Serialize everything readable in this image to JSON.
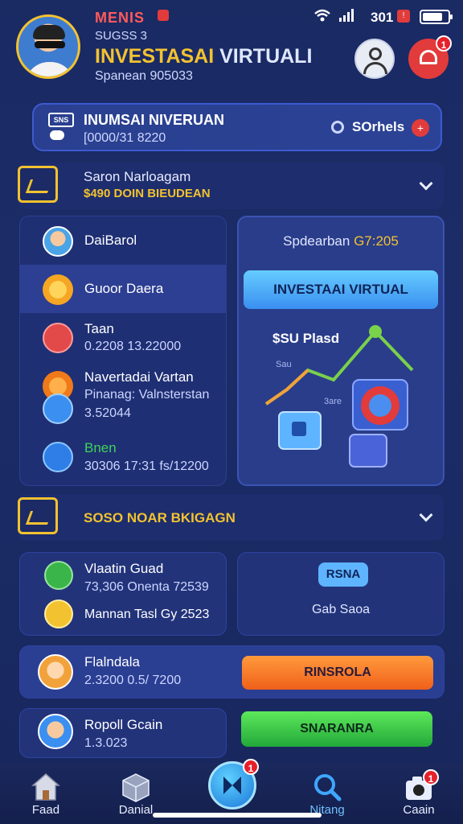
{
  "status": {
    "time": "301"
  },
  "header": {
    "brand": "MENIS",
    "subline": "SUGSS 3",
    "title_a": "INVESTASAI",
    "title_b": "VIRTUALI",
    "tagline": "Spanean 905033"
  },
  "notice": {
    "title": "INUMSAI NIVERUAN",
    "subtitle": "[0000/31 8220",
    "box_label": "SNS",
    "filter_label": "SOrhels"
  },
  "section1": {
    "title": "Saron Narloagam",
    "subtitle": "$490 DOIN BIEUDEAN"
  },
  "list": [
    {
      "title": "DaiBarol",
      "sub": ""
    },
    {
      "title": "Guoor Daera",
      "sub": ""
    },
    {
      "title": "Taan",
      "sub": "0.2208 13.22000"
    },
    {
      "title": "Navertadai Vartan",
      "sub": "Pinanag: Valnsterstan"
    },
    {
      "title": "",
      "sub": "3.52044"
    },
    {
      "title": "Bnen",
      "sub": "30306 17:31 fs/12200"
    }
  ],
  "promo": {
    "head_a": "Spdearban",
    "head_b": "G7:205",
    "button": "INVESTAAI VIRTUAL",
    "chart_label": "$SU Plasd",
    "chart_small1": "Sau",
    "chart_small2": "3are"
  },
  "section2": {
    "title": "SOSO NOAR BKIGAGN"
  },
  "cards": {
    "left_title1": "Vlaatin Guad",
    "left_sub1": "73,306 Onenta 72539",
    "left_sub2": "Mannan Tasl Gy 2523",
    "right_badge": "RSNA",
    "right_text": "Gab Saoa",
    "row2_title": "Flalndala",
    "row2_sub": "2.3200 0.5/ 7200",
    "row2_button": "RINSROLA",
    "row3_title": "Ropoll Gcain",
    "row3_sub": "1.3.023",
    "row3_button": "SNARANRA"
  },
  "nav": {
    "item1": "Faad",
    "item2": "Danial",
    "item4": "Nitang",
    "item5": "Caain",
    "badge_center": "1",
    "badge_camera": "1"
  },
  "badges": {
    "notif": "1"
  },
  "colors": {
    "accent_yellow": "#f2c230",
    "accent_red": "#e23b3b",
    "orange_button": "#ff7a2a",
    "green_button": "#2ec53a",
    "blue_button": "#3a8ff0"
  }
}
